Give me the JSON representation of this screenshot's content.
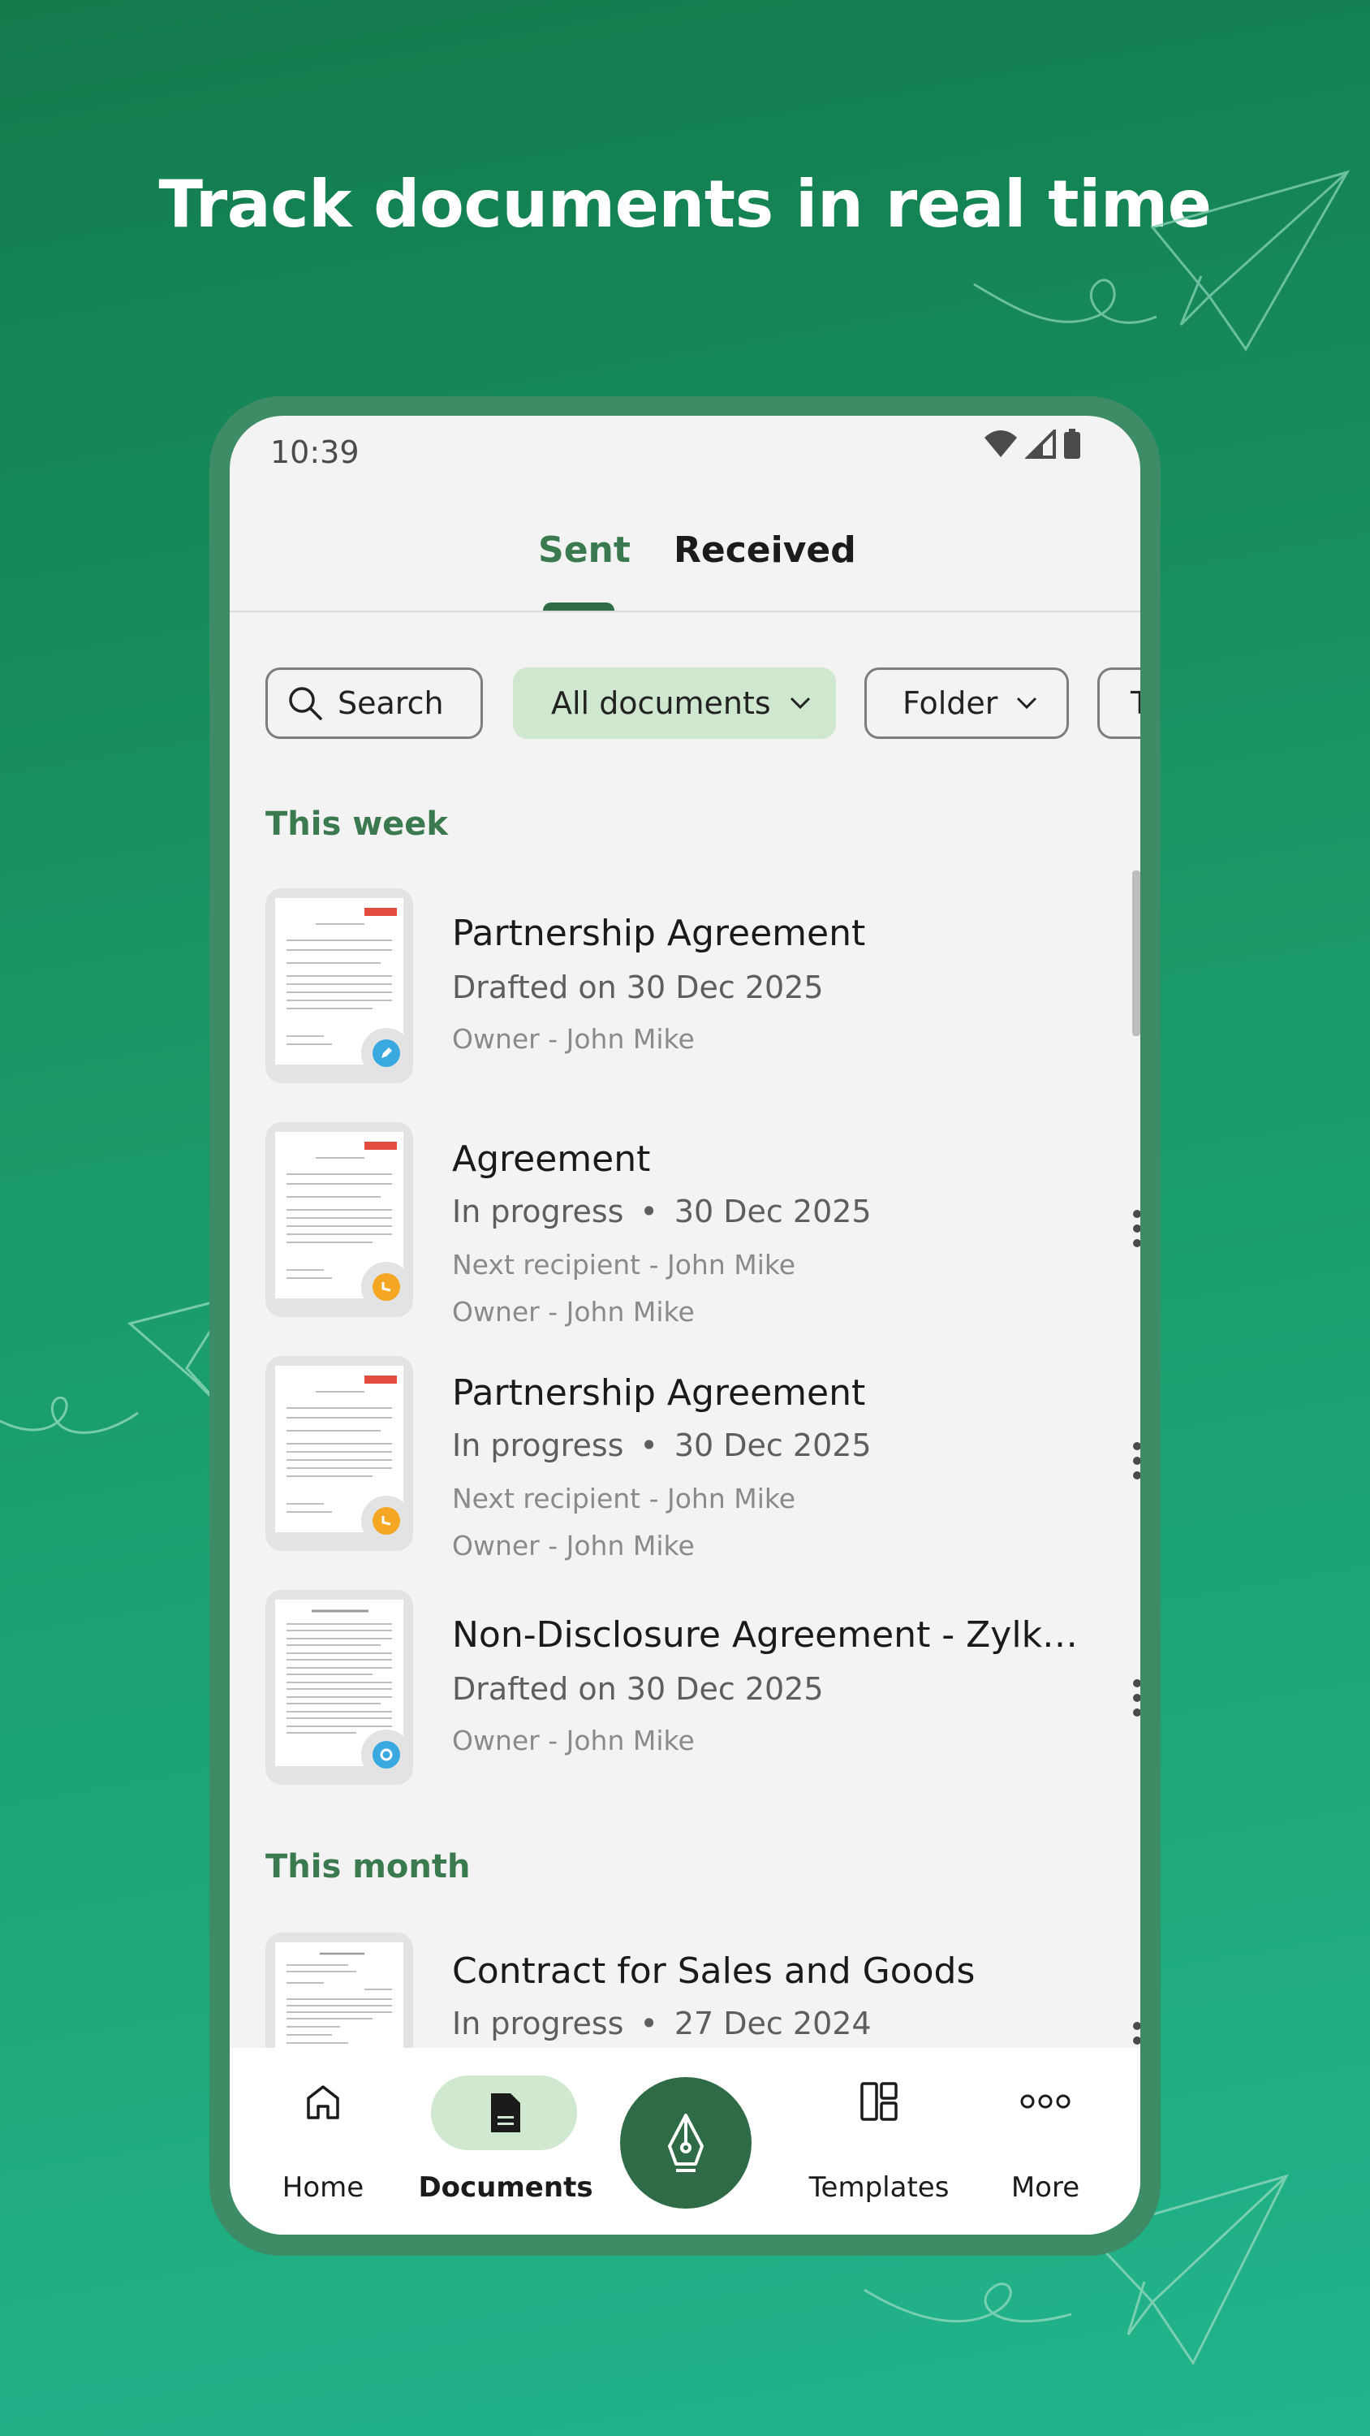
{
  "headline": "Track documents in real time",
  "status_bar": {
    "time": "10:39"
  },
  "tabs": [
    {
      "label": "Sent",
      "active": true
    },
    {
      "label": "Received",
      "active": false
    }
  ],
  "filters": {
    "search_label": "Search",
    "all_documents_label": "All documents",
    "folder_label": "Folder",
    "overflow_label": "T"
  },
  "sections": [
    {
      "title": "This week"
    },
    {
      "title": "This month"
    }
  ],
  "documents": [
    {
      "title": "Partnership Agreement",
      "status": "Drafted on 30 Dec 2025",
      "owner": "Owner - John Mike",
      "badge": "draft"
    },
    {
      "title": "Agreement",
      "status": "In progress",
      "date": "30 Dec 2025",
      "next_recipient": "Next recipient - John Mike",
      "owner": "Owner - John Mike",
      "badge": "in-progress"
    },
    {
      "title": "Partnership Agreement",
      "status": "In progress",
      "date": "30 Dec 2025",
      "next_recipient": "Next recipient - John Mike",
      "owner": "Owner - John Mike",
      "badge": "in-progress"
    },
    {
      "title": "Non-Disclosure Agreement - Zylk…",
      "status": "Drafted on 30 Dec 2025",
      "owner": "Owner - John Mike",
      "badge": "template"
    },
    {
      "title": "Contract for Sales and Goods",
      "status": "In progress",
      "date": "27 Dec 2024"
    }
  ],
  "separator": "•",
  "bottom_nav": {
    "home": "Home",
    "documents": "Documents",
    "templates": "Templates",
    "more": "More"
  },
  "colors": {
    "accent": "#2f6b46",
    "chip_selected": "#cfe7cf",
    "badge_blue": "#3aa9e0",
    "badge_orange": "#f5a623"
  }
}
